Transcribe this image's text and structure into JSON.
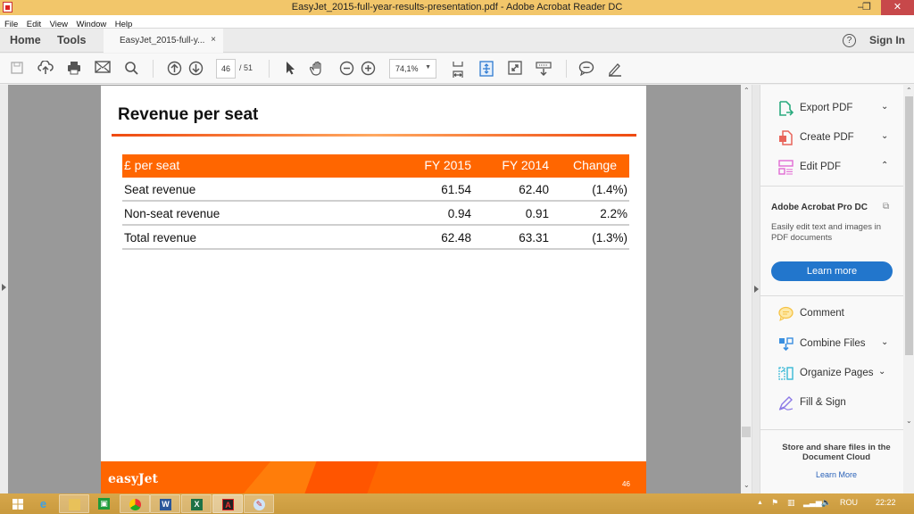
{
  "window": {
    "title": "EasyJet_2015-full-year-results-presentation.pdf - Adobe Acrobat Reader DC",
    "controls": {
      "minimize": "–",
      "maximize": "❐",
      "close": "✕"
    }
  },
  "menu": [
    "File",
    "Edit",
    "View",
    "Window",
    "Help"
  ],
  "tabs": {
    "home": "Home",
    "tools": "Tools",
    "document": "EasyJet_2015-full-y...",
    "document_close": "×",
    "help": "?",
    "sign_in": "Sign In"
  },
  "toolbar": {
    "icons": [
      "save-icon",
      "upload-cloud-icon",
      "print-icon",
      "email-icon",
      "search-icon",
      "page-up-icon",
      "page-down-icon",
      "select-cursor-icon",
      "hand-icon",
      "zoom-out-icon",
      "zoom-in-icon",
      "fit-page-icon",
      "rotate-fit-icon",
      "full-screen-icon",
      "read-mode-icon",
      "comment-icon",
      "highlight-pen-icon"
    ],
    "page_current": "46",
    "page_total": "/ 51",
    "zoom": "74,1%"
  },
  "document": {
    "slide_title": "Revenue per seat",
    "table": {
      "headers": [
        "£ per seat",
        "FY 2015",
        "FY 2014",
        "Change"
      ],
      "rows": [
        [
          "Seat revenue",
          "61.54",
          "62.40",
          "(1.4%)"
        ],
        [
          "Non-seat revenue",
          "0.94",
          "0.91",
          "2.2%"
        ],
        [
          "Total revenue",
          "62.48",
          "63.31",
          "(1.3%)"
        ]
      ]
    },
    "footer_brand": "easyJet",
    "page_number": "46",
    "colors": {
      "brand_orange": "#ff6600"
    }
  },
  "right_pane": {
    "tools": [
      {
        "label": "Export PDF",
        "icon": "export-pdf-icon",
        "chevron": "⌄",
        "color": "#2bab7f"
      },
      {
        "label": "Create PDF",
        "icon": "create-pdf-icon",
        "chevron": "⌄",
        "color": "#e8645a"
      },
      {
        "label": "Edit PDF",
        "icon": "edit-pdf-icon",
        "chevron": "⌃",
        "color": "#e26bd4"
      }
    ],
    "promo": {
      "title": "Adobe Acrobat Pro DC",
      "desc": "Easily edit text and images in PDF documents",
      "button": "Learn more"
    },
    "tools2": [
      {
        "label": "Comment",
        "icon": "comment-icon",
        "chevron": "",
        "color": "#f6c244"
      },
      {
        "label": "Combine Files",
        "icon": "combine-files-icon",
        "chevron": "⌄",
        "color": "#3a8fe0"
      },
      {
        "label": "Organize Pages",
        "icon": "organize-pages-icon",
        "chevron": "⌄",
        "color": "#39b9d6"
      },
      {
        "label": "Fill & Sign",
        "icon": "fill-sign-icon",
        "chevron": "",
        "color": "#8b78e6"
      }
    ],
    "cloud": {
      "text": "Store and share files in the Document Cloud",
      "link": "Learn More"
    }
  },
  "taskbar": {
    "apps": [
      "start",
      "internet-explorer",
      "file-explorer",
      "store",
      "chrome",
      "word",
      "excel",
      "acrobat-reader",
      "paint"
    ],
    "language": "ROU",
    "time": "22:22"
  }
}
